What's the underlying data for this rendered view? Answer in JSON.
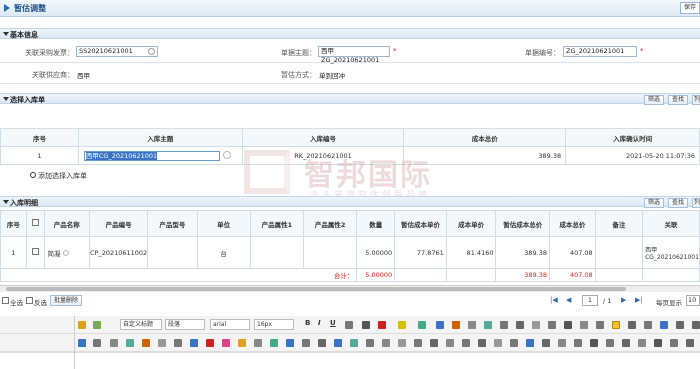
{
  "page": {
    "title": "暂估调整",
    "save_label": "保存"
  },
  "basic": {
    "section_label": "基本信息",
    "invoice_label": "关联采购发票：",
    "invoice_value": "SS20210621001",
    "subject_label": "单据主题：",
    "subject_value": "西甲ZG_20210621001",
    "number_label": "单据编号：",
    "number_value": "ZG_20210621001",
    "supplier_label": "关联供应商：",
    "supplier_value": "西甲",
    "method_label": "暂估方式：",
    "method_value": "单到回冲"
  },
  "inbound": {
    "section_label": "选择入库单",
    "btn_filter": "筛选",
    "btn_search": "查找",
    "btn_extra": "列",
    "headers": [
      "序号",
      "入库主题",
      "入库编号",
      "成本总价",
      "入库确认时间"
    ],
    "rows": [
      [
        "1",
        "西甲CG_20210621001",
        "RK_20210621001",
        "389.38",
        "2021-05-20 11:07:36"
      ]
    ],
    "add_label": "添加选择入库单"
  },
  "detail": {
    "section_label": "入库明细",
    "btn_filter": "筛选",
    "btn_search": "查找",
    "btn_extra": "列",
    "headers": [
      "序号",
      "产品名称",
      "产品编号",
      "产品型号",
      "单位",
      "产品属性1",
      "产品属性2",
      "数量",
      "暂估成本单价",
      "成本单价",
      "暂估成本总价",
      "成本总价",
      "备注",
      "关联"
    ],
    "rows": [
      [
        "1",
        "简凝",
        "CP_20210611002",
        "",
        "台",
        "",
        "",
        "5.00000",
        "77.8761",
        "81.4160",
        "389.38",
        "407.08",
        "",
        "西甲 CG_20210621001"
      ]
    ],
    "total_label": "合计：",
    "total_qty": "5.00000",
    "total_est": "389.38",
    "total_cost": "407.08"
  },
  "pager": {
    "select_all": "全选",
    "invert": "反选",
    "bulk_delete": "批量删除",
    "page": "1",
    "of": "/ 1",
    "per_page_label": "每页显示",
    "per_page": "10"
  },
  "editor": {
    "style": "自定义标题",
    "para": "段落",
    "font": "arial",
    "size": "16px"
  }
}
